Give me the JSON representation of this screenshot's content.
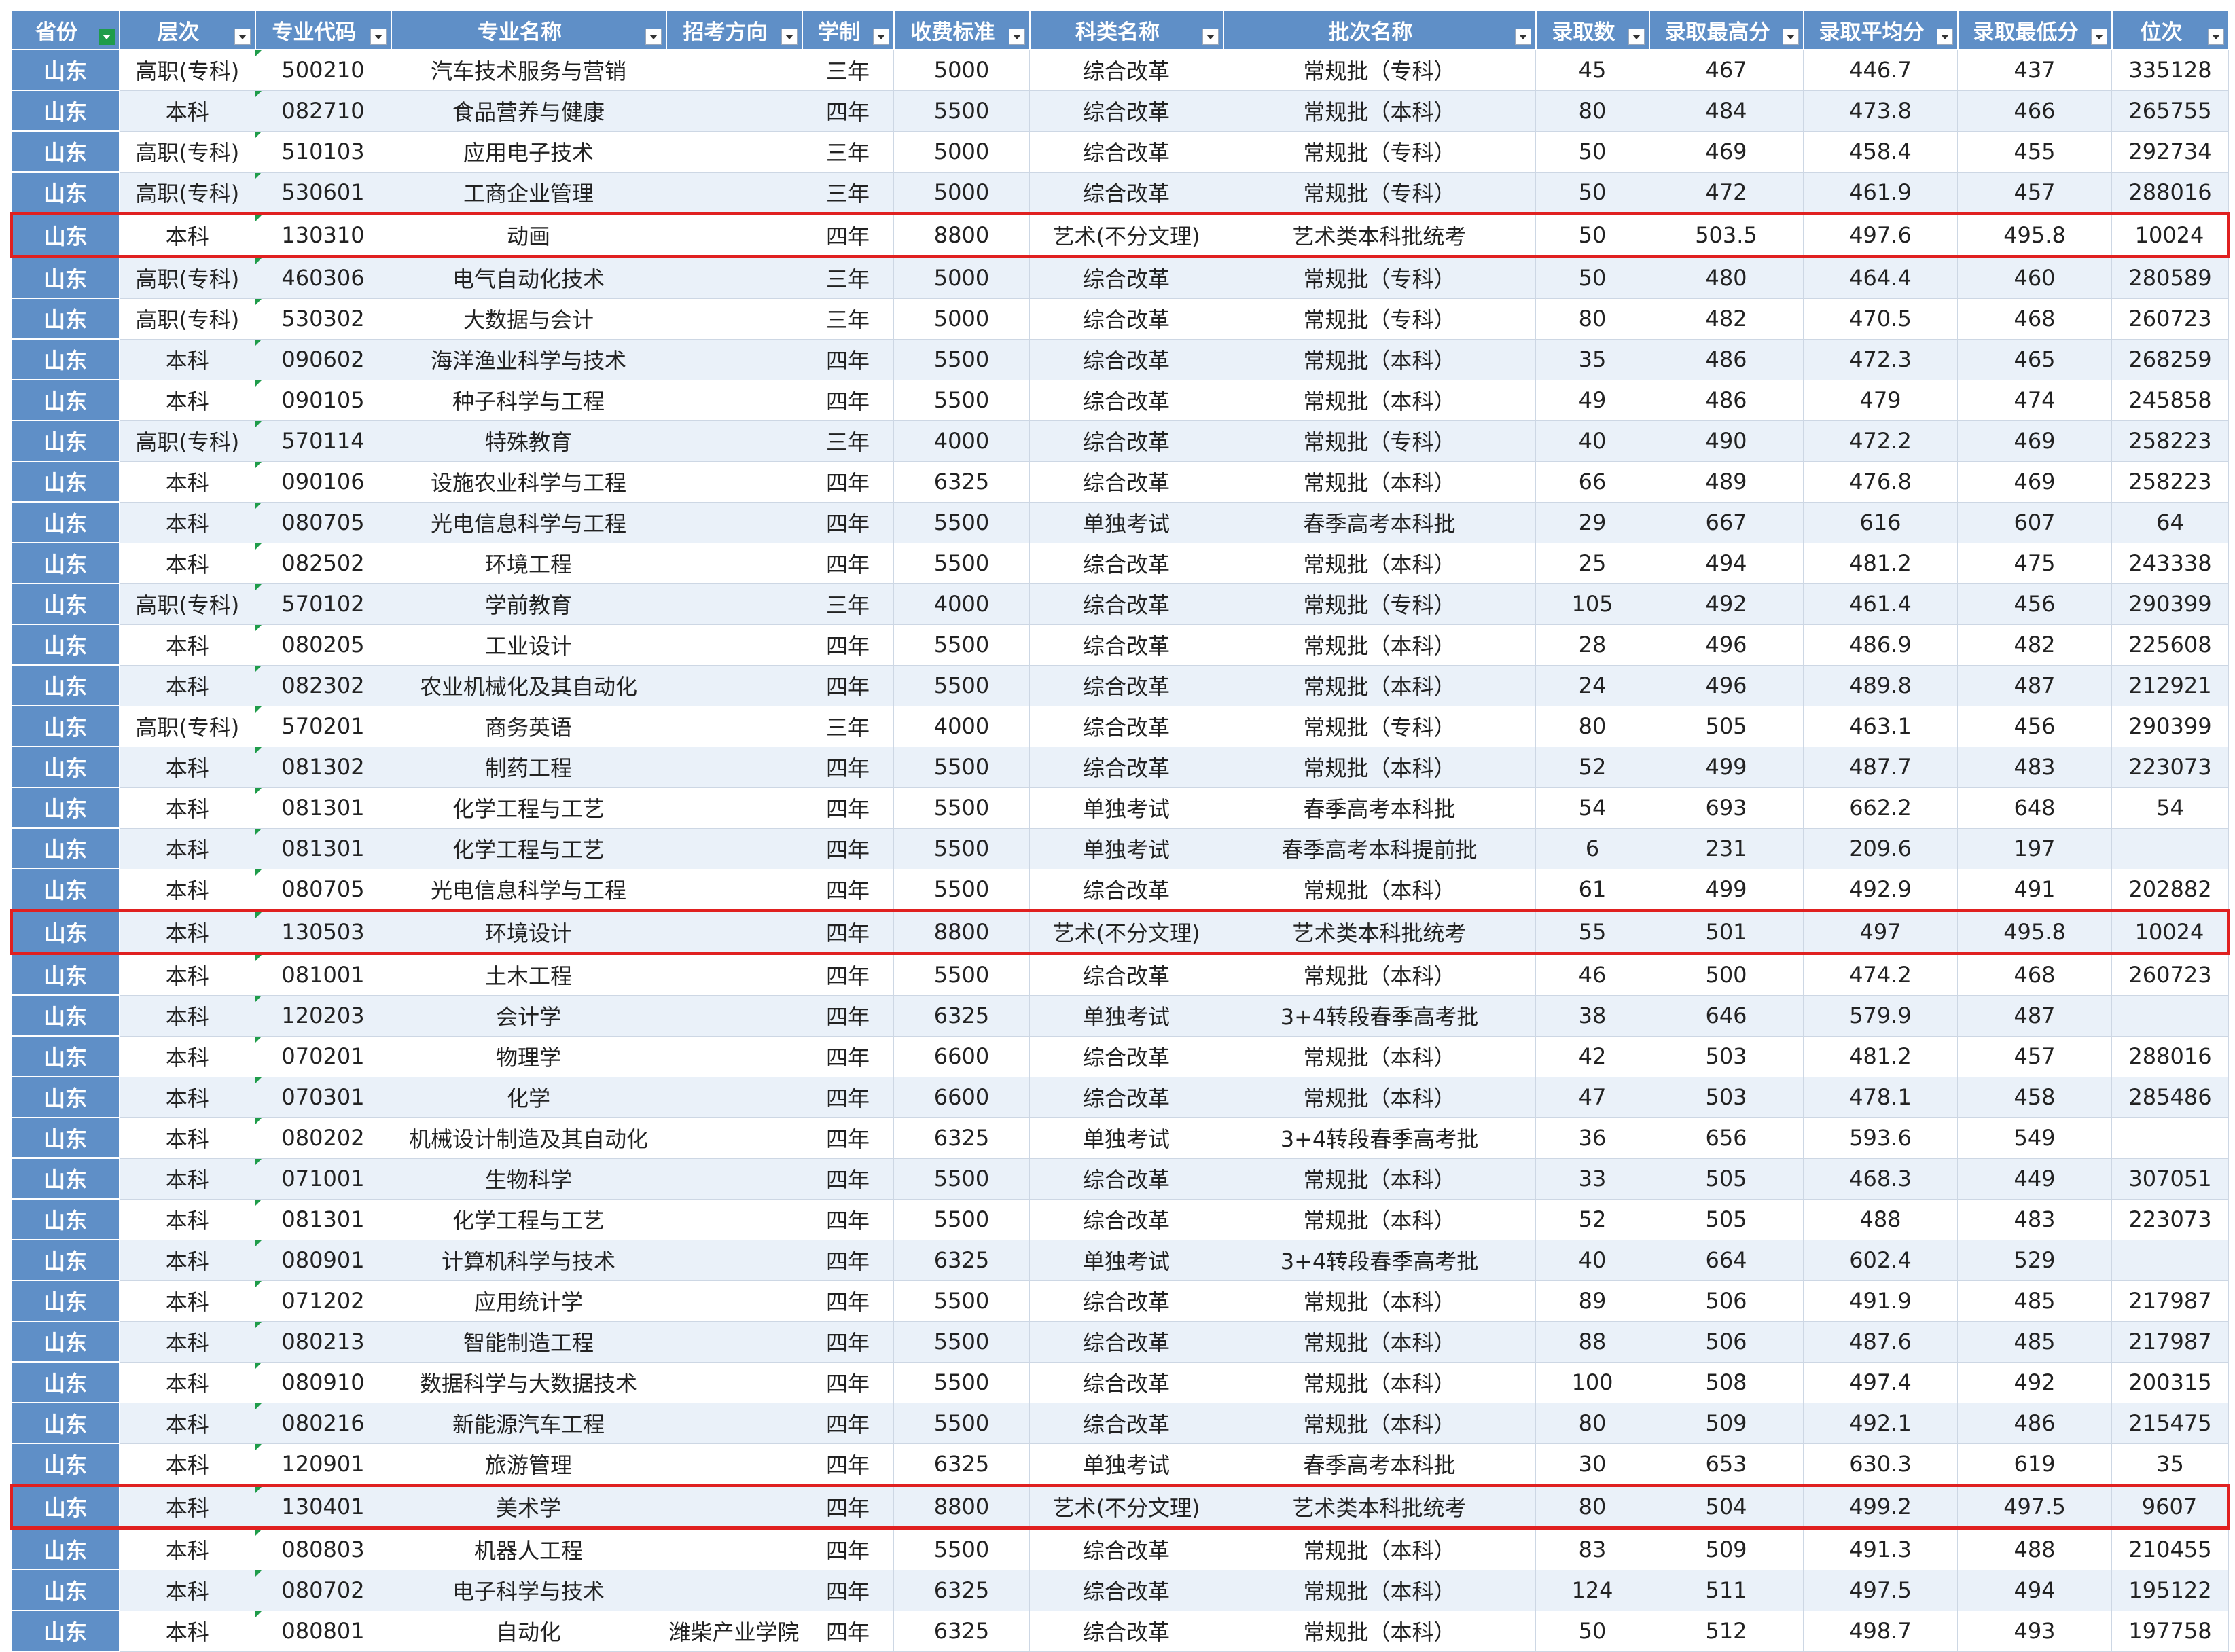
{
  "headers": [
    "省份",
    "层次",
    "专业代码",
    "专业名称",
    "招考方向",
    "学制",
    "收费标准",
    "科类名称",
    "批次名称",
    "录取数",
    "录取最高分",
    "录取平均分",
    "录取最低分",
    "位次"
  ],
  "colors": {
    "header_bg": "#5f8fc7",
    "highlight_border": "#e02020",
    "row_alt": "#eaf1f9",
    "filter_active": "#1f9c4a"
  },
  "rows": [
    [
      "山东",
      "高职(专科)",
      "500210",
      "汽车技术服务与营销",
      "",
      "三年",
      "5000",
      "综合改革",
      "常规批（专科）",
      "45",
      "467",
      "446.7",
      "437",
      "335128"
    ],
    [
      "山东",
      "本科",
      "082710",
      "食品营养与健康",
      "",
      "四年",
      "5500",
      "综合改革",
      "常规批（本科）",
      "80",
      "484",
      "473.8",
      "466",
      "265755"
    ],
    [
      "山东",
      "高职(专科)",
      "510103",
      "应用电子技术",
      "",
      "三年",
      "5000",
      "综合改革",
      "常规批（专科）",
      "50",
      "469",
      "458.4",
      "455",
      "292734"
    ],
    [
      "山东",
      "高职(专科)",
      "530601",
      "工商企业管理",
      "",
      "三年",
      "5000",
      "综合改革",
      "常规批（专科）",
      "50",
      "472",
      "461.9",
      "457",
      "288016"
    ],
    [
      "山东",
      "本科",
      "130310",
      "动画",
      "",
      "四年",
      "8800",
      "艺术(不分文理)",
      "艺术类本科批统考",
      "50",
      "503.5",
      "497.6",
      "495.8",
      "10024"
    ],
    [
      "山东",
      "高职(专科)",
      "460306",
      "电气自动化技术",
      "",
      "三年",
      "5000",
      "综合改革",
      "常规批（专科）",
      "50",
      "480",
      "464.4",
      "460",
      "280589"
    ],
    [
      "山东",
      "高职(专科)",
      "530302",
      "大数据与会计",
      "",
      "三年",
      "5000",
      "综合改革",
      "常规批（专科）",
      "80",
      "482",
      "470.5",
      "468",
      "260723"
    ],
    [
      "山东",
      "本科",
      "090602",
      "海洋渔业科学与技术",
      "",
      "四年",
      "5500",
      "综合改革",
      "常规批（本科）",
      "35",
      "486",
      "472.3",
      "465",
      "268259"
    ],
    [
      "山东",
      "本科",
      "090105",
      "种子科学与工程",
      "",
      "四年",
      "5500",
      "综合改革",
      "常规批（本科）",
      "49",
      "486",
      "479",
      "474",
      "245858"
    ],
    [
      "山东",
      "高职(专科)",
      "570114",
      "特殊教育",
      "",
      "三年",
      "4000",
      "综合改革",
      "常规批（专科）",
      "40",
      "490",
      "472.2",
      "469",
      "258223"
    ],
    [
      "山东",
      "本科",
      "090106",
      "设施农业科学与工程",
      "",
      "四年",
      "6325",
      "综合改革",
      "常规批（本科）",
      "66",
      "489",
      "476.8",
      "469",
      "258223"
    ],
    [
      "山东",
      "本科",
      "080705",
      "光电信息科学与工程",
      "",
      "四年",
      "5500",
      "单独考试",
      "春季高考本科批",
      "29",
      "667",
      "616",
      "607",
      "64"
    ],
    [
      "山东",
      "本科",
      "082502",
      "环境工程",
      "",
      "四年",
      "5500",
      "综合改革",
      "常规批（本科）",
      "25",
      "494",
      "481.2",
      "475",
      "243338"
    ],
    [
      "山东",
      "高职(专科)",
      "570102",
      "学前教育",
      "",
      "三年",
      "4000",
      "综合改革",
      "常规批（专科）",
      "105",
      "492",
      "461.4",
      "456",
      "290399"
    ],
    [
      "山东",
      "本科",
      "080205",
      "工业设计",
      "",
      "四年",
      "5500",
      "综合改革",
      "常规批（本科）",
      "28",
      "496",
      "486.9",
      "482",
      "225608"
    ],
    [
      "山东",
      "本科",
      "082302",
      "农业机械化及其自动化",
      "",
      "四年",
      "5500",
      "综合改革",
      "常规批（本科）",
      "24",
      "496",
      "489.8",
      "487",
      "212921"
    ],
    [
      "山东",
      "高职(专科)",
      "570201",
      "商务英语",
      "",
      "三年",
      "4000",
      "综合改革",
      "常规批（专科）",
      "80",
      "505",
      "463.1",
      "456",
      "290399"
    ],
    [
      "山东",
      "本科",
      "081302",
      "制药工程",
      "",
      "四年",
      "5500",
      "综合改革",
      "常规批（本科）",
      "52",
      "499",
      "487.7",
      "483",
      "223073"
    ],
    [
      "山东",
      "本科",
      "081301",
      "化学工程与工艺",
      "",
      "四年",
      "5500",
      "单独考试",
      "春季高考本科批",
      "54",
      "693",
      "662.2",
      "648",
      "54"
    ],
    [
      "山东",
      "本科",
      "081301",
      "化学工程与工艺",
      "",
      "四年",
      "5500",
      "单独考试",
      "春季高考本科提前批",
      "6",
      "231",
      "209.6",
      "197",
      ""
    ],
    [
      "山东",
      "本科",
      "080705",
      "光电信息科学与工程",
      "",
      "四年",
      "5500",
      "综合改革",
      "常规批（本科）",
      "61",
      "499",
      "492.9",
      "491",
      "202882"
    ],
    [
      "山东",
      "本科",
      "130503",
      "环境设计",
      "",
      "四年",
      "8800",
      "艺术(不分文理)",
      "艺术类本科批统考",
      "55",
      "501",
      "497",
      "495.8",
      "10024"
    ],
    [
      "山东",
      "本科",
      "081001",
      "土木工程",
      "",
      "四年",
      "5500",
      "综合改革",
      "常规批（本科）",
      "46",
      "500",
      "474.2",
      "468",
      "260723"
    ],
    [
      "山东",
      "本科",
      "120203",
      "会计学",
      "",
      "四年",
      "6325",
      "单独考试",
      "3+4转段春季高考批",
      "38",
      "646",
      "579.9",
      "487",
      ""
    ],
    [
      "山东",
      "本科",
      "070201",
      "物理学",
      "",
      "四年",
      "6600",
      "综合改革",
      "常规批（本科）",
      "42",
      "503",
      "481.2",
      "457",
      "288016"
    ],
    [
      "山东",
      "本科",
      "070301",
      "化学",
      "",
      "四年",
      "6600",
      "综合改革",
      "常规批（本科）",
      "47",
      "503",
      "478.1",
      "458",
      "285486"
    ],
    [
      "山东",
      "本科",
      "080202",
      "机械设计制造及其自动化",
      "",
      "四年",
      "6325",
      "单独考试",
      "3+4转段春季高考批",
      "36",
      "656",
      "593.6",
      "549",
      ""
    ],
    [
      "山东",
      "本科",
      "071001",
      "生物科学",
      "",
      "四年",
      "5500",
      "综合改革",
      "常规批（本科）",
      "33",
      "505",
      "468.3",
      "449",
      "307051"
    ],
    [
      "山东",
      "本科",
      "081301",
      "化学工程与工艺",
      "",
      "四年",
      "5500",
      "综合改革",
      "常规批（本科）",
      "52",
      "505",
      "488",
      "483",
      "223073"
    ],
    [
      "山东",
      "本科",
      "080901",
      "计算机科学与技术",
      "",
      "四年",
      "6325",
      "单独考试",
      "3+4转段春季高考批",
      "40",
      "664",
      "602.4",
      "529",
      ""
    ],
    [
      "山东",
      "本科",
      "071202",
      "应用统计学",
      "",
      "四年",
      "5500",
      "综合改革",
      "常规批（本科）",
      "89",
      "506",
      "491.9",
      "485",
      "217987"
    ],
    [
      "山东",
      "本科",
      "080213",
      "智能制造工程",
      "",
      "四年",
      "5500",
      "综合改革",
      "常规批（本科）",
      "88",
      "506",
      "487.6",
      "485",
      "217987"
    ],
    [
      "山东",
      "本科",
      "080910",
      "数据科学与大数据技术",
      "",
      "四年",
      "5500",
      "综合改革",
      "常规批（本科）",
      "100",
      "508",
      "497.4",
      "492",
      "200315"
    ],
    [
      "山东",
      "本科",
      "080216",
      "新能源汽车工程",
      "",
      "四年",
      "5500",
      "综合改革",
      "常规批（本科）",
      "80",
      "509",
      "492.1",
      "486",
      "215475"
    ],
    [
      "山东",
      "本科",
      "120901",
      "旅游管理",
      "",
      "四年",
      "6325",
      "单独考试",
      "春季高考本科批",
      "30",
      "653",
      "630.3",
      "619",
      "35"
    ],
    [
      "山东",
      "本科",
      "130401",
      "美术学",
      "",
      "四年",
      "8800",
      "艺术(不分文理)",
      "艺术类本科批统考",
      "80",
      "504",
      "499.2",
      "497.5",
      "9607"
    ],
    [
      "山东",
      "本科",
      "080803",
      "机器人工程",
      "",
      "四年",
      "5500",
      "综合改革",
      "常规批（本科）",
      "83",
      "509",
      "491.3",
      "488",
      "210455"
    ],
    [
      "山东",
      "本科",
      "080702",
      "电子科学与技术",
      "",
      "四年",
      "6325",
      "综合改革",
      "常规批（本科）",
      "124",
      "511",
      "497.5",
      "494",
      "195122"
    ],
    [
      "山东",
      "本科",
      "080801",
      "自动化",
      "潍柴产业学院",
      "四年",
      "6325",
      "综合改革",
      "常规批（本科）",
      "50",
      "512",
      "498.7",
      "493",
      "197758"
    ]
  ],
  "highlighted_rows": [
    4,
    21,
    35
  ],
  "filtered_column": 0
}
